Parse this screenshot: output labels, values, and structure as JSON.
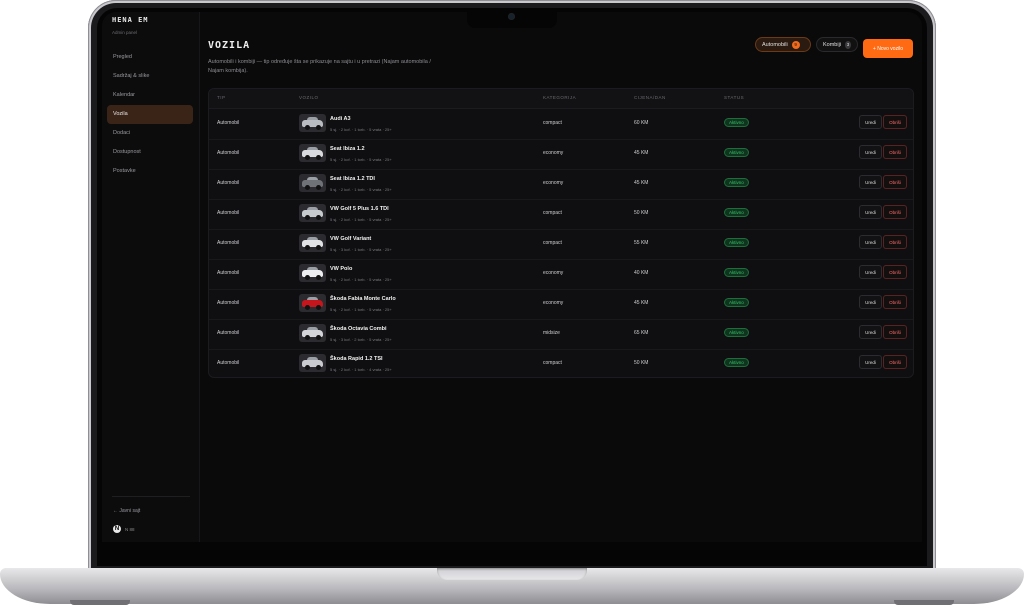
{
  "brand": {
    "title": "HENA EM",
    "subtitle": "Admin panel"
  },
  "nav": [
    {
      "label": "Pregled",
      "active": false
    },
    {
      "label": "Sadržaj & slike",
      "active": false
    },
    {
      "label": "Kalendar",
      "active": false
    },
    {
      "label": "Vozila",
      "active": true
    },
    {
      "label": "Dodaci",
      "active": false
    },
    {
      "label": "Dostupnost",
      "active": false
    },
    {
      "label": "Postavke",
      "active": false
    }
  ],
  "sidebar_footer": {
    "back_label": "← Javni sajt",
    "avatar_letter": "N",
    "user_text": "N 88"
  },
  "header": {
    "title": "VOZILA",
    "description": "Automobili i kombiji — tip određuje šta se prikazuje na sajtu i u pretrazi (Najam automobila / Najam kombija).",
    "tabs": [
      {
        "label": "Automobili",
        "count": "9",
        "active": true
      },
      {
        "label": "Kombiji",
        "count": "3",
        "active": false
      }
    ],
    "new_button": "+ Novo vozilo"
  },
  "table": {
    "columns": [
      "TIP",
      "VOZILO",
      "KATEGORIJA",
      "CIJENA/DAN",
      "STATUS"
    ],
    "rows": [
      {
        "tip": "Automobil",
        "name": "Audi A3",
        "spec": "5 sj. · 2 kof. · 1 torb. · 5 vrata · 25+",
        "category": "compact",
        "price": "60 KM",
        "status": "Aktivno",
        "edit": "Uredi",
        "delete": "Obriši",
        "car_color": "#b9bcc0"
      },
      {
        "tip": "Automobil",
        "name": "Seat Ibiza 1.2",
        "spec": "5 sj. · 2 kof. · 1 torb. · 5 vrata · 25+",
        "category": "economy",
        "price": "45 KM",
        "status": "Aktivno",
        "edit": "Uredi",
        "delete": "Obriši",
        "car_color": "#d8dadd"
      },
      {
        "tip": "Automobil",
        "name": "Seat Ibiza 1.2 TDI",
        "spec": "5 sj. · 2 kof. · 1 torb. · 5 vrata · 25+",
        "category": "economy",
        "price": "45 KM",
        "status": "Aktivno",
        "edit": "Uredi",
        "delete": "Obriši",
        "car_color": "#6f7378"
      },
      {
        "tip": "Automobil",
        "name": "VW Golf 5 Plus 1.6 TDI",
        "spec": "5 sj. · 2 kof. · 1 torb. · 5 vrata · 25+",
        "category": "compact",
        "price": "50 KM",
        "status": "Aktivno",
        "edit": "Uredi",
        "delete": "Obriši",
        "car_color": "#c8cbce"
      },
      {
        "tip": "Automobil",
        "name": "VW Golf Variant",
        "spec": "5 sj. · 3 kof. · 1 torb. · 5 vrata · 25+",
        "category": "compact",
        "price": "55 KM",
        "status": "Aktivno",
        "edit": "Uredi",
        "delete": "Obriši",
        "car_color": "#e0e2e4"
      },
      {
        "tip": "Automobil",
        "name": "VW Polo",
        "spec": "5 sj. · 2 kof. · 1 torb. · 5 vrata · 25+",
        "category": "economy",
        "price": "40 KM",
        "status": "Aktivno",
        "edit": "Uredi",
        "delete": "Obriši",
        "car_color": "#eceef0"
      },
      {
        "tip": "Automobil",
        "name": "Škoda Fabia Monte Carlo",
        "spec": "5 sj. · 2 kof. · 1 torb. · 5 vrata · 25+",
        "category": "economy",
        "price": "45 KM",
        "status": "Aktivno",
        "edit": "Uredi",
        "delete": "Obriši",
        "car_color": "#c4161c"
      },
      {
        "tip": "Automobil",
        "name": "Škoda Octavia Combi",
        "spec": "5 sj. · 3 kof. · 2 torb. · 5 vrata · 25+",
        "category": "midsize",
        "price": "65 KM",
        "status": "Aktivno",
        "edit": "Uredi",
        "delete": "Obriši",
        "car_color": "#d3d5d8"
      },
      {
        "tip": "Automobil",
        "name": "Škoda Rapid 1.2 TSI",
        "spec": "5 sj. · 2 kof. · 1 torb. · 4 vrata · 25+",
        "category": "compact",
        "price": "50 KM",
        "status": "Aktivno",
        "edit": "Uredi",
        "delete": "Obriši",
        "car_color": "#c9cbcf"
      }
    ]
  }
}
